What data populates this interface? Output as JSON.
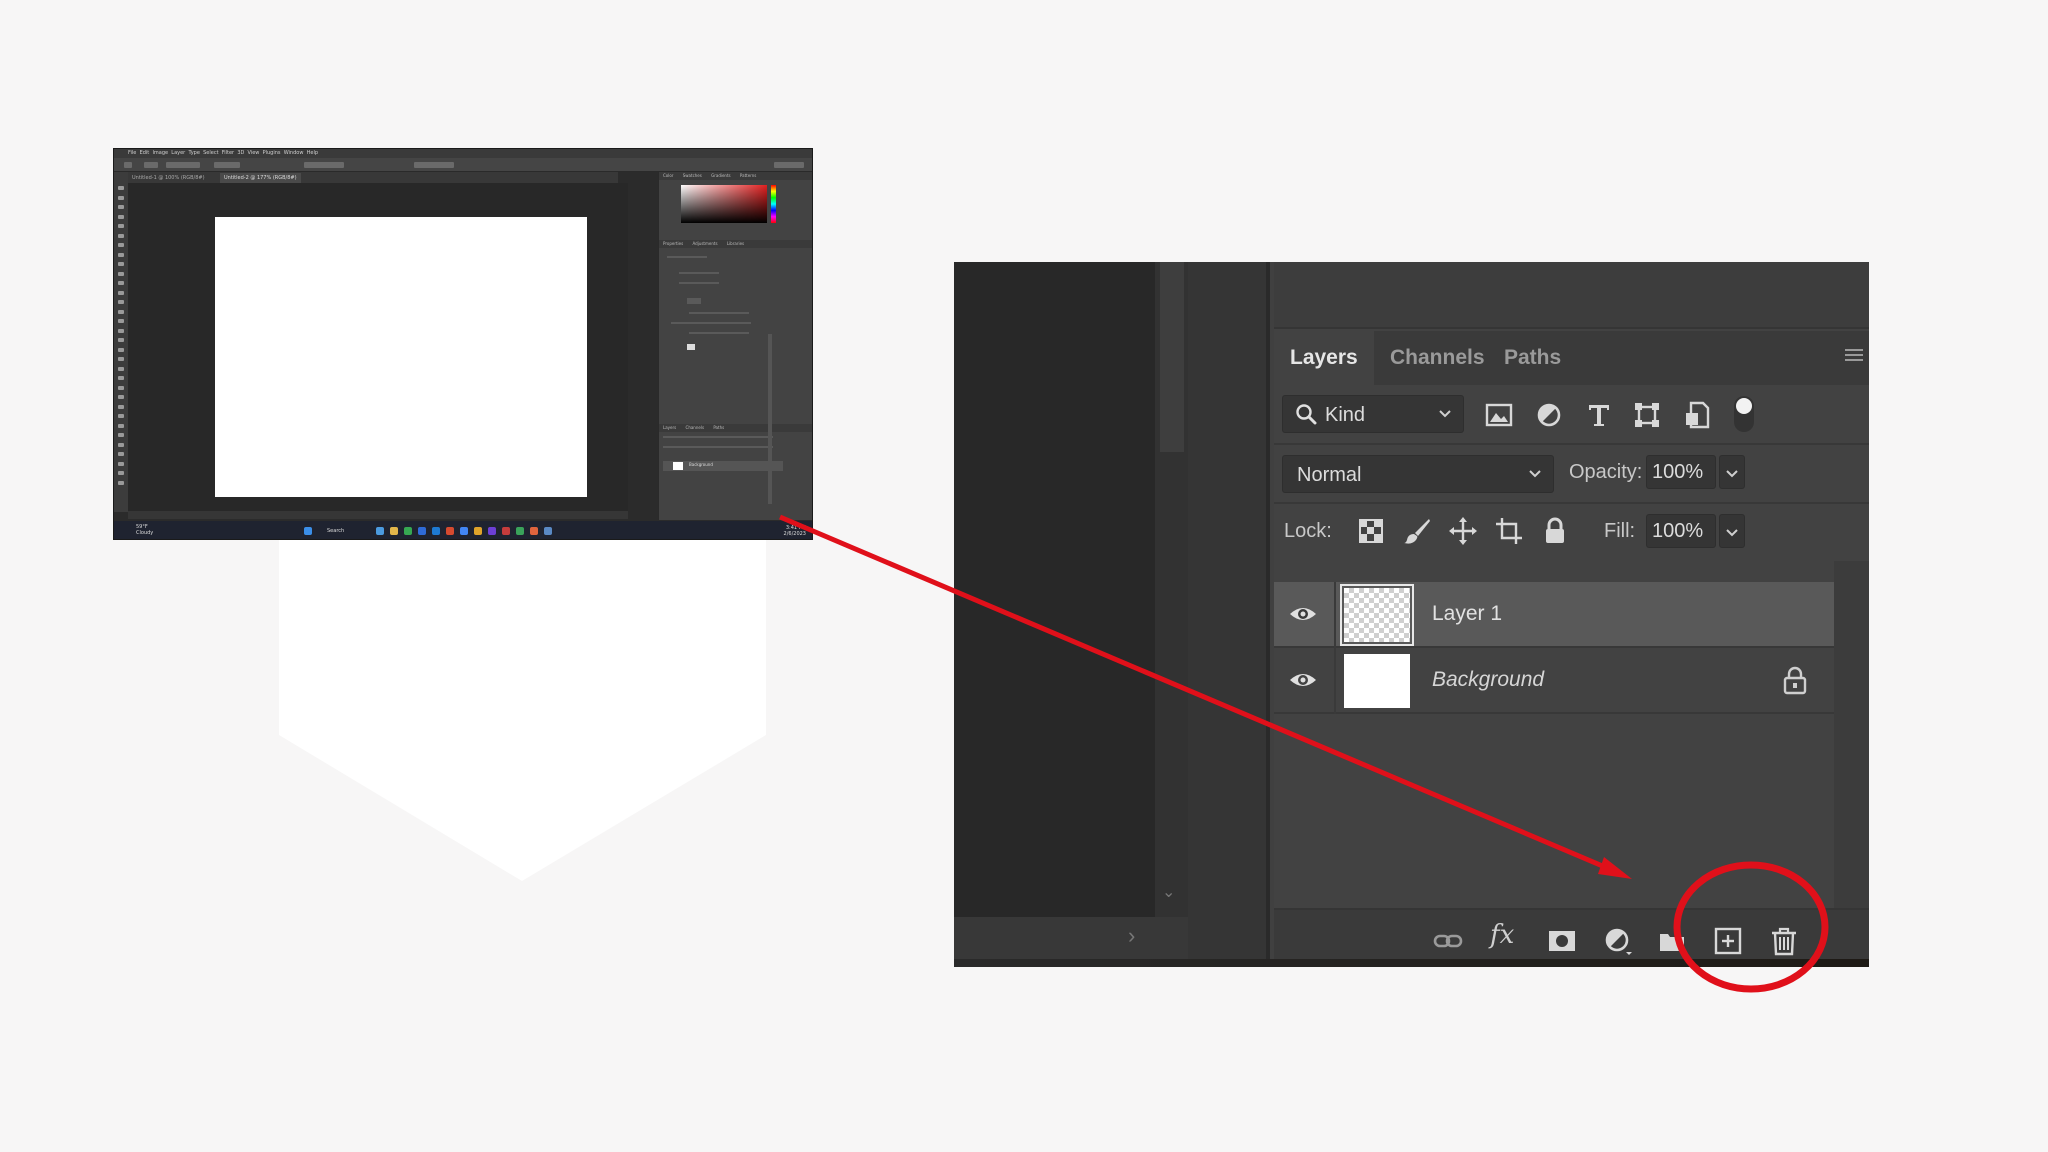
{
  "mini_screenshot": {
    "menu": [
      "File",
      "Edit",
      "Image",
      "Layer",
      "Type",
      "Select",
      "Filter",
      "3D",
      "View",
      "Plugins",
      "Window",
      "Help"
    ],
    "tabs": [
      "Untitled-1 @ 100% (RGB/8#)",
      "Untitled-2 @ 177% (RGB/8#)"
    ],
    "panel_tabs_top": [
      "Color",
      "Swatches",
      "Gradients",
      "Patterns"
    ],
    "panel_tabs_mid": [
      "Properties",
      "Adjustments",
      "Libraries"
    ],
    "panel_tabs_bottom": [
      "Layers",
      "Channels",
      "Paths"
    ],
    "layer_name": "Background",
    "weather": {
      "temp": "59°F",
      "condition": "Cloudy"
    },
    "taskbar_search": "Search",
    "clock": {
      "time": "3:41 PM",
      "date": "2/6/2023"
    }
  },
  "layers_panel": {
    "tabs": [
      {
        "label": "Layers",
        "active": true
      },
      {
        "label": "Channels",
        "active": false
      },
      {
        "label": "Paths",
        "active": false
      }
    ],
    "filter": {
      "label": "Kind"
    },
    "filter_icons": [
      "image-filter-icon",
      "adjustment-filter-icon",
      "type-filter-icon",
      "shape-filter-icon",
      "smart-object-filter-icon"
    ],
    "blend_mode": "Normal",
    "opacity_label": "Opacity:",
    "opacity_value": "100%",
    "lock_label": "Lock:",
    "fill_label": "Fill:",
    "fill_value": "100%",
    "layers": [
      {
        "name": "Layer 1",
        "visible": true,
        "selected": true,
        "thumbnail": "transparent"
      },
      {
        "name": "Background",
        "visible": true,
        "selected": false,
        "thumbnail": "white",
        "locked": true
      }
    ],
    "footer_icons": [
      "link-layers-icon",
      "fx-icon",
      "layer-mask-icon",
      "adjustment-layer-icon",
      "new-group-icon",
      "new-layer-icon",
      "delete-layer-icon"
    ],
    "footer_fx_text": "fx"
  },
  "annotation": {
    "color": "#e0101a",
    "highlighted_control": "new-layer-icon"
  },
  "colors": {
    "panel_bg": "#424242",
    "selected_layer_bg": "#595959",
    "page_bg": "#f7f6f6"
  }
}
